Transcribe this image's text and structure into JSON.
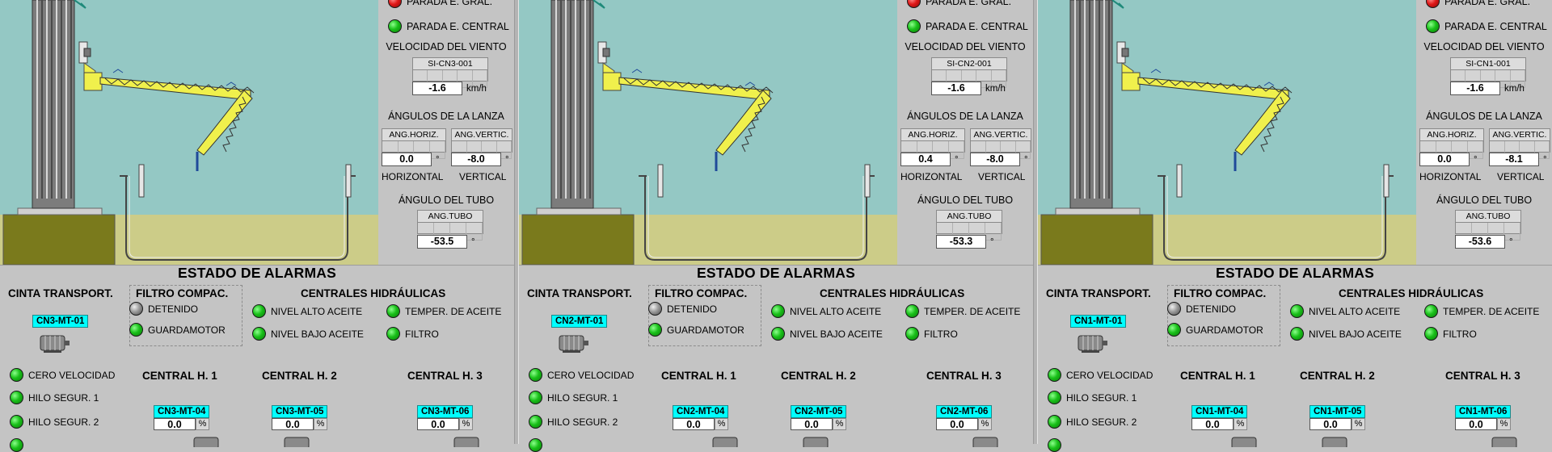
{
  "panels": [
    {
      "side": {
        "parada_gral": "PARADA E. GRAL.",
        "parada_central": "PARADA E. CENTRAL",
        "velocidad_title": "VELOCIDAD DEL VIENTO",
        "wind_tag": "SI-CN3-001",
        "wind_value": "-1.6",
        "wind_unit": "km/h",
        "angulos_title": "ÁNGULOS DE LA LANZA",
        "ang_horiz_tag": "ANG.HORIZ.",
        "ang_vertic_tag": "ANG.VERTIC.",
        "ang_horiz_value": "0.0",
        "ang_vertic_value": "-8.0",
        "deg": "°",
        "horizontal_label": "HORIZONTAL",
        "vertical_label": "VERTICAL",
        "tubo_title": "ÁNGULO DEL TUBO",
        "tubo_tag": "ANG.TUBO",
        "tubo_value": "-53.5"
      },
      "alarms": {
        "title": "ESTADO DE ALARMAS",
        "cinta_title": "CINTA TRANSPORT.",
        "cinta_tag": "CN3-MT-01",
        "filtro_title": "FILTRO COMPAC.",
        "filtro_items": [
          "DETENIDO",
          "GUARDAMOTOR"
        ],
        "centrales_title": "CENTRALES HIDRÁULICAS",
        "centrales_items": [
          "NIVEL ALTO ACEITE",
          "TEMPER. DE ACEITE",
          "NIVEL BAJO ACEITE",
          "FILTRO"
        ],
        "cinta_items": [
          "CERO VELOCIDAD",
          "HILO SEGUR. 1",
          "HILO SEGUR. 2"
        ],
        "ch1": "CENTRAL H. 1",
        "ch2": "CENTRAL H. 2",
        "ch3": "CENTRAL H. 3",
        "ch1_tag": "CN3-MT-04",
        "ch2_tag": "CN3-MT-05",
        "ch3_tag": "CN3-MT-06",
        "ch1_val": "0.0",
        "ch2_val": "0.0",
        "ch3_val": "0.0",
        "pct": "%"
      }
    },
    {
      "side": {
        "parada_gral": "PARADA E. GRAL.",
        "parada_central": "PARADA E. CENTRAL",
        "velocidad_title": "VELOCIDAD DEL VIENTO",
        "wind_tag": "SI-CN2-001",
        "wind_value": "-1.6",
        "wind_unit": "km/h",
        "angulos_title": "ÁNGULOS DE LA LANZA",
        "ang_horiz_tag": "ANG.HORIZ.",
        "ang_vertic_tag": "ANG.VERTIC.",
        "ang_horiz_value": "0.4",
        "ang_vertic_value": "-8.0",
        "deg": "°",
        "horizontal_label": "HORIZONTAL",
        "vertical_label": "VERTICAL",
        "tubo_title": "ÁNGULO DEL TUBO",
        "tubo_tag": "ANG.TUBO",
        "tubo_value": "-53.3"
      },
      "alarms": {
        "title": "ESTADO DE ALARMAS",
        "cinta_title": "CINTA TRANSPORT.",
        "cinta_tag": "CN2-MT-01",
        "filtro_title": "FILTRO COMPAC.",
        "filtro_items": [
          "DETENIDO",
          "GUARDAMOTOR"
        ],
        "centrales_title": "CENTRALES HIDRÁULICAS",
        "centrales_items": [
          "NIVEL ALTO ACEITE",
          "TEMPER. DE ACEITE",
          "NIVEL BAJO ACEITE",
          "FILTRO"
        ],
        "cinta_items": [
          "CERO VELOCIDAD",
          "HILO SEGUR. 1",
          "HILO SEGUR. 2"
        ],
        "ch1": "CENTRAL H. 1",
        "ch2": "CENTRAL H. 2",
        "ch3": "CENTRAL H. 3",
        "ch1_tag": "CN2-MT-04",
        "ch2_tag": "CN2-MT-05",
        "ch3_tag": "CN2-MT-06",
        "ch1_val": "0.0",
        "ch2_val": "0.0",
        "ch3_val": "0.0",
        "pct": "%"
      }
    },
    {
      "side": {
        "parada_gral": "PARADA E. GRAL.",
        "parada_central": "PARADA E. CENTRAL",
        "velocidad_title": "VELOCIDAD DEL VIENTO",
        "wind_tag": "SI-CN1-001",
        "wind_value": "-1.6",
        "wind_unit": "km/h",
        "angulos_title": "ÁNGULOS DE LA LANZA",
        "ang_horiz_tag": "ANG.HORIZ.",
        "ang_vertic_tag": "ANG.VERTIC.",
        "ang_horiz_value": "0.0",
        "ang_vertic_value": "-8.1",
        "deg": "°",
        "horizontal_label": "HORIZONTAL",
        "vertical_label": "VERTICAL",
        "tubo_title": "ÁNGULO DEL TUBO",
        "tubo_tag": "ANG.TUBO",
        "tubo_value": "-53.6"
      },
      "alarms": {
        "title": "ESTADO DE ALARMAS",
        "cinta_title": "CINTA TRANSPORT.",
        "cinta_tag": "CN1-MT-01",
        "filtro_title": "FILTRO COMPAC.",
        "filtro_items": [
          "DETENIDO",
          "GUARDAMOTOR"
        ],
        "centrales_title": "CENTRALES HIDRÁULICAS",
        "centrales_items": [
          "NIVEL ALTO ACEITE",
          "TEMPER. DE ACEITE",
          "NIVEL BAJO ACEITE",
          "FILTRO"
        ],
        "cinta_items": [
          "CERO VELOCIDAD",
          "HILO SEGUR. 1",
          "HILO SEGUR. 2"
        ],
        "ch1": "CENTRAL H. 1",
        "ch2": "CENTRAL H. 2",
        "ch3": "CENTRAL H. 3",
        "ch1_tag": "CN1-MT-04",
        "ch2_tag": "CN1-MT-05",
        "ch3_tag": "CN1-MT-06",
        "ch1_val": "0.0",
        "ch2_val": "0.0",
        "ch3_val": "0.0",
        "pct": "%"
      }
    }
  ],
  "colors": {
    "sky": "#94c8c4",
    "ground": "#7a7a1c",
    "sand": "#cccc88",
    "boom": "#f0f04c",
    "led_green": "#19c019",
    "led_red": "#e01818",
    "tag_cyan": "#00ffff"
  },
  "icons": {
    "status_green": "green-led-icon",
    "status_red": "red-led-icon",
    "status_gray": "gray-led-icon",
    "motor": "motor-icon"
  }
}
